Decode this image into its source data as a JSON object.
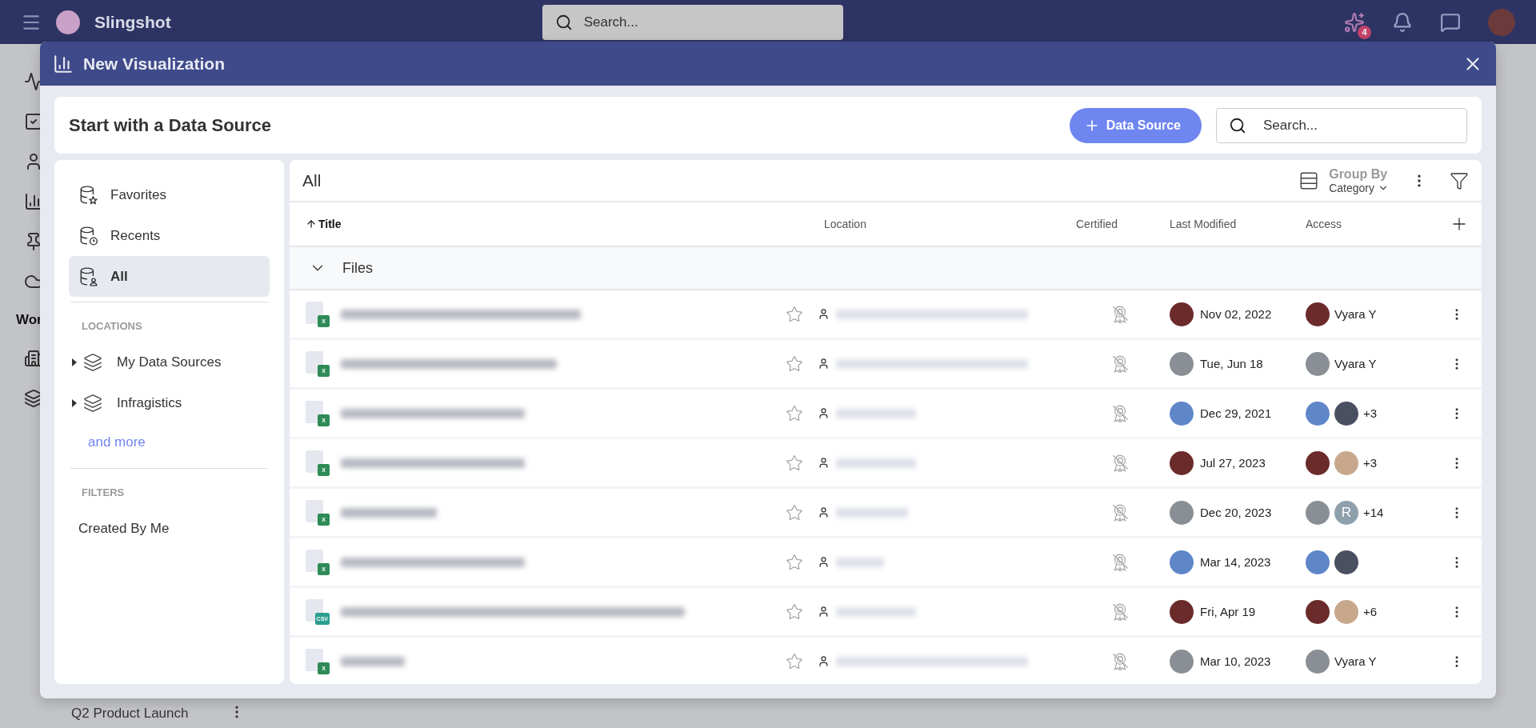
{
  "topbar": {
    "app_name": "Slingshot",
    "search": {
      "placeholder": "Search..."
    },
    "badge": "4"
  },
  "background": {
    "section_label": "Wor",
    "item": "Q2 Product Launch"
  },
  "dialog": {
    "title": "New Visualization",
    "heading": "Start with a Data Source",
    "add_button": "Data Source",
    "search": {
      "placeholder": "Search..."
    }
  },
  "sidebar": {
    "items": [
      {
        "kind": "favorites",
        "label": "Favorites",
        "selected": false
      },
      {
        "kind": "recents",
        "label": "Recents",
        "selected": false
      },
      {
        "kind": "all",
        "label": "All",
        "selected": true
      }
    ],
    "locations_heading": "LOCATIONS",
    "locations": [
      {
        "label": "My Data Sources",
        "expanded": false
      },
      {
        "label": "Infragistics",
        "expanded": false
      }
    ],
    "more_link": "and more",
    "filters_heading": "FILTERS",
    "filters": [
      {
        "label": "Created By Me"
      }
    ]
  },
  "main": {
    "title": "All",
    "group_by": {
      "label": "Group By",
      "value": "Category"
    },
    "columns": [
      {
        "label": "Title",
        "sorted": true
      },
      {
        "label": "Location",
        "sorted": false
      },
      {
        "label": "Certified",
        "sorted": false
      },
      {
        "label": "Last Modified",
        "sorted": false
      },
      {
        "label": "Access",
        "sorted": false
      }
    ],
    "group": {
      "label": "Files",
      "expanded": true
    },
    "rows": [
      {
        "kind": "spreadsheet",
        "badge": "X",
        "favorite": false,
        "certified": false,
        "modified": "Nov 02, 2022",
        "access": [
          {
            "kind": "photo"
          }
        ],
        "access_label": "Vyara Y"
      },
      {
        "kind": "spreadsheet",
        "badge": "X",
        "favorite": false,
        "certified": false,
        "modified": "Tue, Jun 18",
        "access": [
          {
            "kind": "photo"
          }
        ],
        "access_label": "Vyara Y"
      },
      {
        "kind": "spreadsheet",
        "badge": "X",
        "favorite": false,
        "certified": false,
        "modified": "Dec 29, 2021",
        "access": [
          {
            "kind": "photo"
          },
          {
            "kind": "photo"
          }
        ],
        "access_label": "+3"
      },
      {
        "kind": "spreadsheet",
        "badge": "X",
        "favorite": false,
        "certified": false,
        "modified": "Jul 27, 2023",
        "access": [
          {
            "kind": "photo"
          },
          {
            "kind": "photo"
          }
        ],
        "access_label": "+3"
      },
      {
        "kind": "spreadsheet",
        "badge": "X",
        "favorite": false,
        "certified": false,
        "modified": "Dec 20, 2023",
        "access": [
          {
            "kind": "photo"
          },
          {
            "kind": "initial",
            "text": "R"
          }
        ],
        "access_label": "+14"
      },
      {
        "kind": "spreadsheet",
        "badge": "X",
        "favorite": false,
        "certified": false,
        "modified": "Mar 14, 2023",
        "access": [
          {
            "kind": "photo"
          },
          {
            "kind": "photo"
          }
        ]
      },
      {
        "kind": "csv",
        "badge": "CSV",
        "favorite": false,
        "certified": false,
        "modified": "Fri, Apr 19",
        "access": [
          {
            "kind": "photo"
          },
          {
            "kind": "photo"
          }
        ],
        "access_label": "+6"
      },
      {
        "kind": "spreadsheet",
        "badge": "X",
        "favorite": false,
        "certified": false,
        "modified": "Mar 10, 2023",
        "access": [
          {
            "kind": "photo"
          }
        ],
        "access_label": "Vyara Y"
      }
    ]
  }
}
